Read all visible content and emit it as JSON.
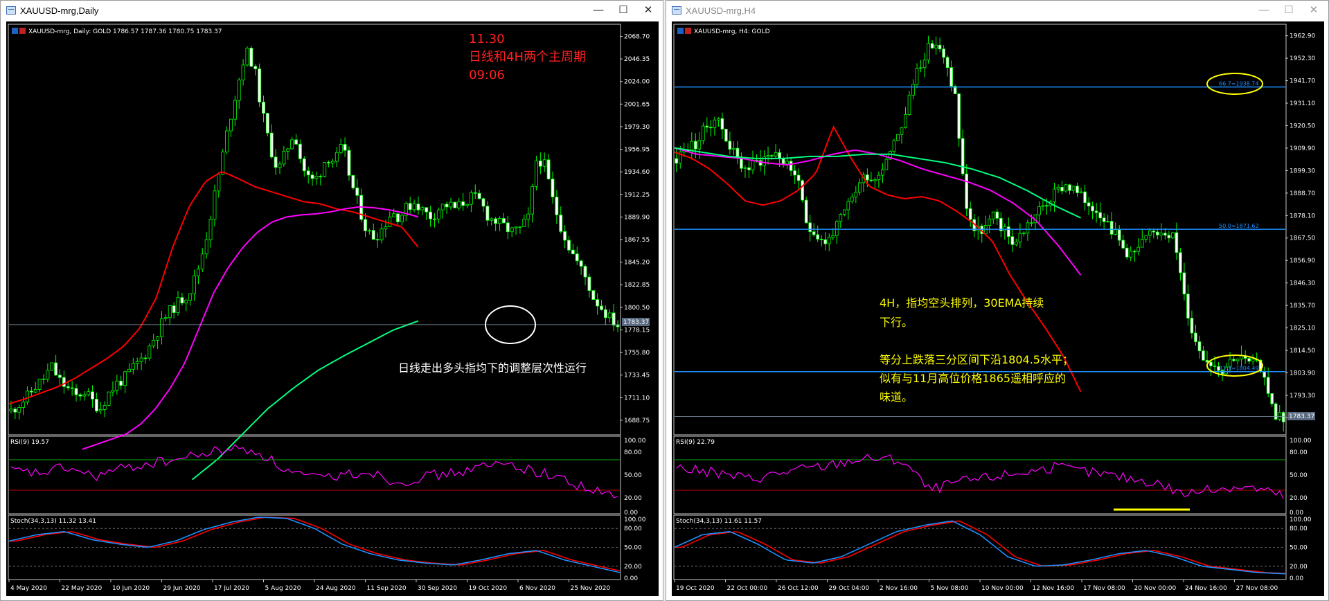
{
  "left_window": {
    "title": "XAUUSD-mrg,Daily",
    "controls": {
      "minimize": "—",
      "maximize": "☐",
      "close": "✕"
    },
    "info_line": "XAUUSD-mrg, Daily:  GOLD   1786.57 1787.36 1780.75 1783.37",
    "annotation_red": [
      "11.30",
      "日线和4H两个主周期",
      "09:06"
    ],
    "annotation_white": "日线走出多头指均下的调整层次性运行",
    "price_marker": "1783.37",
    "rsi_label": "RSI(9) 19.57",
    "stoch_label": "Stoch(34,3,13) 11.32 13.41"
  },
  "right_window": {
    "title": "XAUUSD-mrg,H4",
    "controls": {
      "minimize": "—",
      "maximize": "☐",
      "close": "✕"
    },
    "info_line": "XAUUSD-mrg, H4:  GOLD",
    "annotation_yellow": [
      "4H，指均空头排列，30EMA持续",
      "下行。",
      "",
      "等分上跌落三分区间下沿1804.5水平；",
      "似有与11月高位价格1865遥相呼应的",
      "味道。"
    ],
    "fib_levels": [
      {
        "label": "66.7=1938.74",
        "value": 1938.74
      },
      {
        "label": "50.0=1871.62",
        "value": 1871.62
      },
      {
        "label": "33.3=1804.49",
        "value": 1804.49
      }
    ],
    "price_marker": "1783.37",
    "rsi_label": "RSI(9) 22.79",
    "stoch_label": "Stoch(34,3,13) 11.61 11.57"
  },
  "colors": {
    "background": "#000000",
    "candle": "#00ff00",
    "ema30": "#ff0000",
    "ma_mid": "#ff00ff",
    "ma_long": "#00ff7f",
    "fib": "#1e90ff",
    "rsi": "#ff00ff",
    "stoch_main": "#1e90ff",
    "stoch_signal": "#ff0000",
    "annotation_yellow": "#ffff00",
    "annotation_red": "#ff2020"
  },
  "chart_data": [
    {
      "type": "candlestick",
      "title": "XAUUSD-mrg,Daily",
      "x_ticks": [
        "4 May 2020",
        "22 May 2020",
        "10 Jun 2020",
        "29 Jun 2020",
        "17 Jul 2020",
        "5 Aug 2020",
        "24 Aug 2020",
        "11 Sep 2020",
        "30 Sep 2020",
        "19 Oct 2020",
        "6 Nov 2020",
        "25 Nov 2020"
      ],
      "y_ticks": [
        "2068.70",
        "2046.35",
        "2024.00",
        "2001.65",
        "1979.30",
        "1956.95",
        "1934.60",
        "1912.25",
        "1889.90",
        "1867.55",
        "1845.20",
        "1822.85",
        "1800.50",
        "1778.15",
        "1755.80",
        "1733.45",
        "1711.10",
        "1688.75"
      ],
      "ylim": [
        1675,
        2080
      ],
      "close_path": [
        1698,
        1705,
        1712,
        1722,
        1730,
        1742,
        1728,
        1720,
        1712,
        1718,
        1708,
        1700,
        1715,
        1725,
        1730,
        1740,
        1748,
        1760,
        1775,
        1790,
        1800,
        1808,
        1815,
        1835,
        1865,
        1905,
        1945,
        1985,
        2020,
        2055,
        2040,
        1995,
        1960,
        1935,
        1955,
        1975,
        1940,
        1925,
        1930,
        1950,
        1945,
        1960,
        1925,
        1900,
        1875,
        1870,
        1880,
        1895,
        1890,
        1900,
        1905,
        1895,
        1890,
        1900,
        1902,
        1898,
        1905,
        1910,
        1905,
        1890,
        1885,
        1880,
        1875,
        1878,
        1890,
        1950,
        1940,
        1905,
        1880,
        1860,
        1845,
        1830,
        1810,
        1800,
        1790,
        1783
      ],
      "ema30_path": [
        1705,
        1710,
        1716,
        1722,
        1730,
        1740,
        1750,
        1762,
        1780,
        1810,
        1860,
        1900,
        1925,
        1935,
        1928,
        1920,
        1915,
        1910,
        1905,
        1903,
        1898,
        1895,
        1890,
        1885,
        1880,
        1860
      ],
      "ma_mid_path": [
        1660,
        1665,
        1670,
        1675,
        1685,
        1700,
        1720,
        1745,
        1780,
        1815,
        1840,
        1860,
        1875,
        1885,
        1890,
        1892,
        1893,
        1895,
        1898,
        1900,
        1899,
        1897,
        1894,
        1890
      ],
      "ma_long_path": [
        1630,
        1650,
        1675,
        1700,
        1720,
        1738,
        1752,
        1765,
        1778,
        1787
      ],
      "rsi": {
        "ylim": [
          0,
          100
        ],
        "levels": [
          70,
          30
        ],
        "y_ticks": [
          "100.00",
          "80.00",
          "50.00",
          "20.00",
          "0.00"
        ]
      },
      "stoch": {
        "ylim": [
          0,
          100
        ],
        "y_ticks": [
          "100.00",
          "80.00",
          "50.00",
          "20.00",
          "0.00"
        ]
      }
    },
    {
      "type": "candlestick",
      "title": "XAUUSD-mrg,H4",
      "x_ticks": [
        "19 Oct 2020",
        "22 Oct 00:00",
        "26 Oct 12:00",
        "29 Oct 04:00",
        "2 Nov 16:00",
        "5 Nov 08:00",
        "10 Nov 00:00",
        "12 Nov 16:00",
        "17 Nov 08:00",
        "20 Nov 00:00",
        "24 Nov 16:00",
        "27 Nov 08:00"
      ],
      "y_ticks": [
        "1962.90",
        "1952.30",
        "1941.70",
        "1931.10",
        "1920.50",
        "1909.90",
        "1899.30",
        "1888.70",
        "1878.10",
        "1867.50",
        "1856.90",
        "1846.30",
        "1835.70",
        "1825.10",
        "1814.50",
        "1803.90",
        "1793.30",
        "1782.70"
      ],
      "ylim": [
        1775,
        1968
      ],
      "price_levels": [
        1938.74,
        1871.62,
        1804.49
      ],
      "close_path": [
        1905,
        1910,
        1912,
        1920,
        1925,
        1915,
        1905,
        1900,
        1903,
        1906,
        1908,
        1902,
        1898,
        1875,
        1870,
        1865,
        1872,
        1880,
        1890,
        1898,
        1895,
        1905,
        1915,
        1925,
        1945,
        1955,
        1960,
        1950,
        1935,
        1885,
        1870,
        1872,
        1878,
        1870,
        1865,
        1872,
        1878,
        1883,
        1888,
        1893,
        1890,
        1885,
        1882,
        1878,
        1870,
        1862,
        1860,
        1866,
        1870,
        1872,
        1868,
        1840,
        1820,
        1812,
        1808,
        1806,
        1812,
        1810,
        1808,
        1805,
        1785,
        1783
      ],
      "ema30_path": [
        1908,
        1905,
        1900,
        1893,
        1885,
        1883,
        1885,
        1890,
        1898,
        1920,
        1905,
        1892,
        1888,
        1886,
        1887,
        1885,
        1880,
        1874,
        1866,
        1850,
        1837,
        1825,
        1812,
        1795
      ],
      "ma_mid_path": [
        1910,
        1907,
        1906,
        1905,
        1903,
        1902,
        1904,
        1907,
        1909,
        1907,
        1904,
        1900,
        1897,
        1894,
        1890,
        1884,
        1876,
        1864,
        1850
      ],
      "ma_long_path": [
        1910,
        1908,
        1906,
        1905,
        1905,
        1906,
        1906,
        1907,
        1907,
        1905,
        1903,
        1900,
        1896,
        1890,
        1883,
        1877
      ],
      "rsi": {
        "ylim": [
          0,
          100
        ],
        "levels": [
          70,
          30
        ],
        "y_ticks": [
          "100.00",
          "80.00",
          "50.00",
          "20.00",
          "0.00"
        ]
      },
      "stoch": {
        "ylim": [
          0,
          100
        ],
        "y_ticks": [
          "100.00",
          "80.00",
          "50.00",
          "20.00",
          "0.00"
        ]
      }
    }
  ]
}
